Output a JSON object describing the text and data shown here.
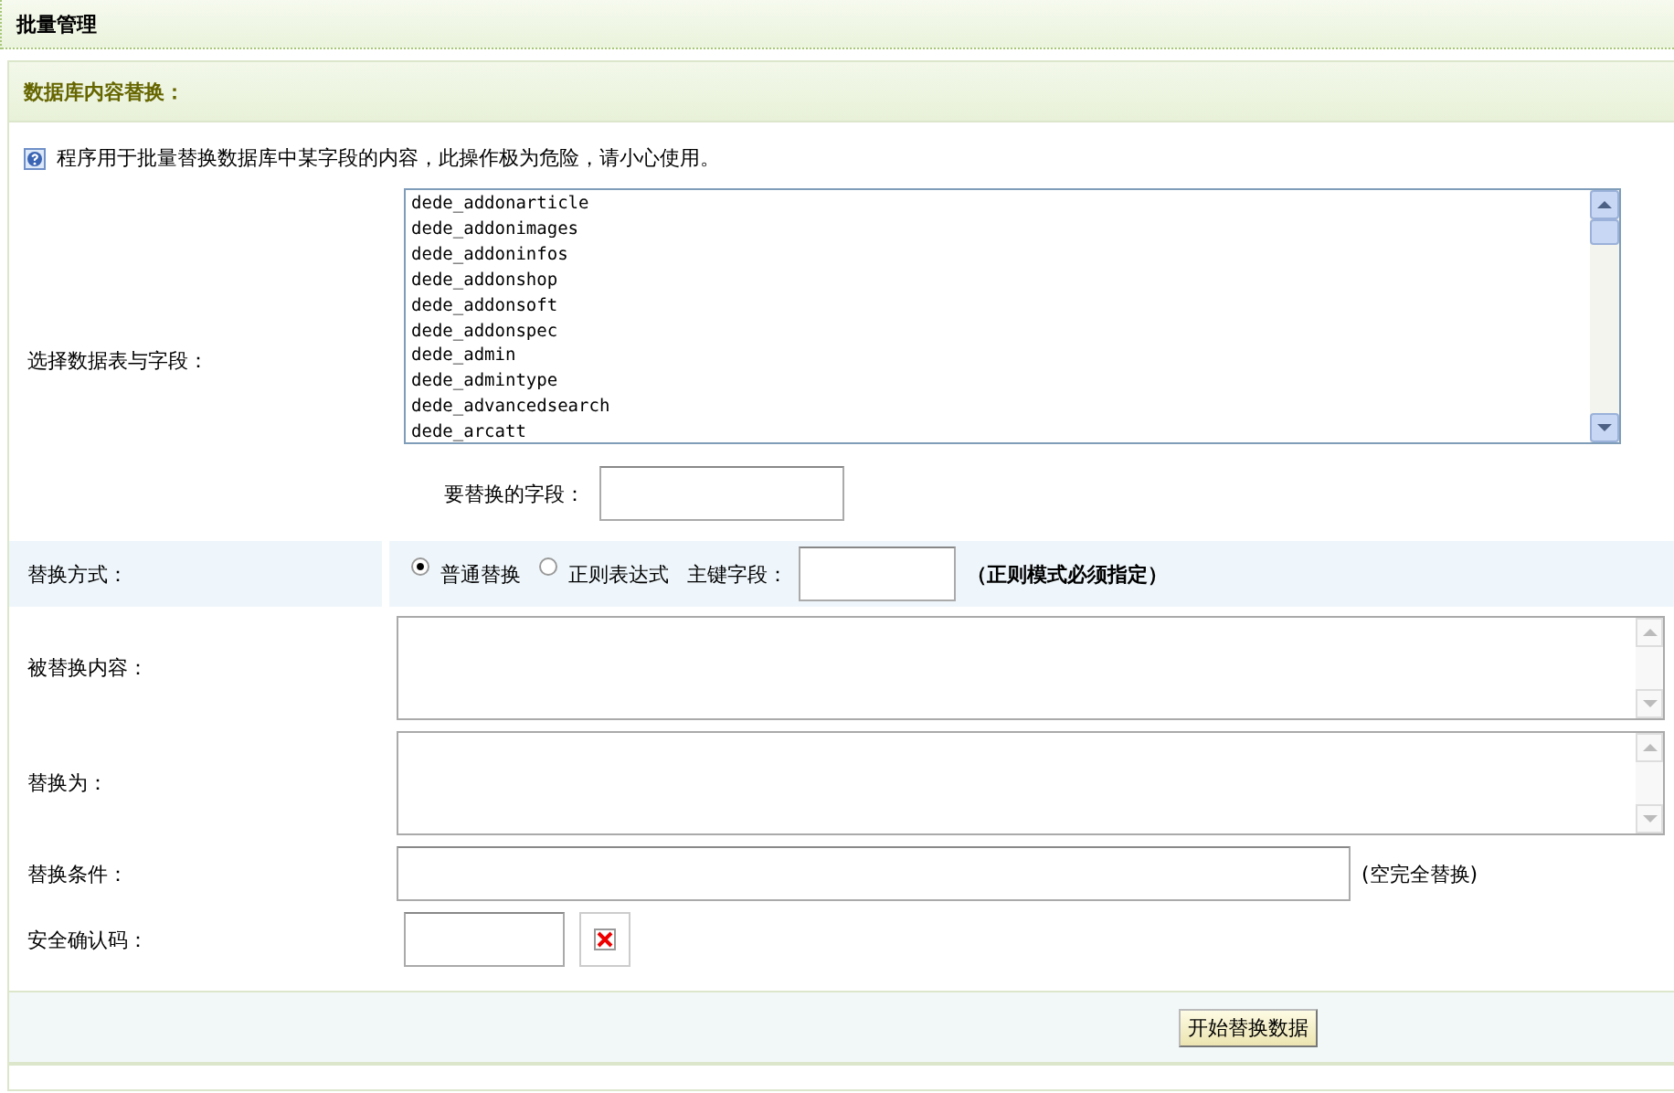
{
  "page_title": "批量管理",
  "section_title": "数据库内容替换：",
  "notice": "程序用于批量替换数据库中某字段的内容，此操作极为危险，请小心使用。",
  "table_select": {
    "label": "选择数据表与字段：",
    "options": [
      "dede_addonarticle",
      "dede_addonimages",
      "dede_addoninfos",
      "dede_addonshop",
      "dede_addonsoft",
      "dede_addonspec",
      "dede_admin",
      "dede_admintype",
      "dede_advancedsearch",
      "dede_arcatt"
    ],
    "field_label": "要替换的字段："
  },
  "method": {
    "label": "替换方式：",
    "options": [
      {
        "label": "普通替换",
        "selected": true
      },
      {
        "label": "正则表达式",
        "selected": false
      }
    ],
    "key_label": "主键字段：",
    "hint": "（正则模式必须指定）"
  },
  "source": {
    "label": "被替换内容："
  },
  "target": {
    "label": "替换为："
  },
  "condition": {
    "label": "替换条件：",
    "hint": "(空完全替换)"
  },
  "captcha": {
    "label": "安全确认码："
  },
  "submit": "开始替换数据"
}
